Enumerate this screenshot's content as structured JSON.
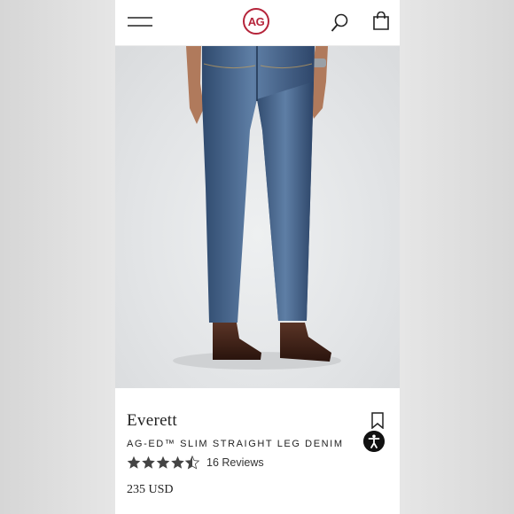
{
  "header": {
    "logo_text": "AG",
    "brand_color": "#b5243a",
    "icons": [
      "menu-icon",
      "search-icon",
      "shopping-bag-icon"
    ]
  },
  "product": {
    "image_alt": "Man wearing medium-wash straight leg jeans and brown leather boots",
    "name": "Everett",
    "subtitle": "AG-ED™ SLIM STRAIGHT LEG DENIM",
    "rating": 4.5,
    "rating_max": 5,
    "reviews_label": "16 Reviews",
    "price": "235 USD"
  },
  "actions": {
    "icons": [
      "bookmark-icon",
      "accessibility-icon"
    ]
  }
}
